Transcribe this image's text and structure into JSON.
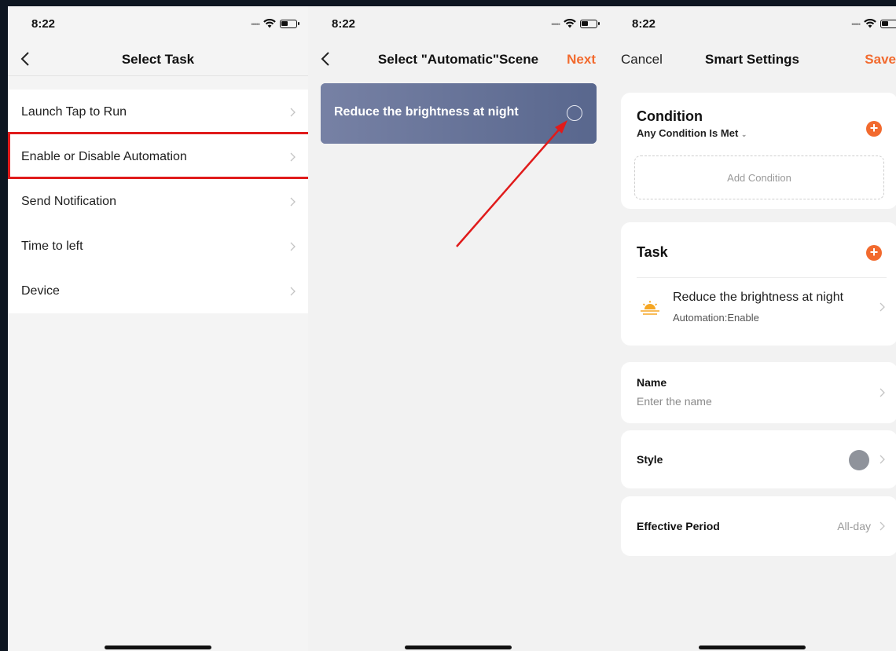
{
  "status_time": "8:22",
  "panel1": {
    "title": "Select Task",
    "items": [
      {
        "label": "Launch Tap to Run"
      },
      {
        "label": "Enable or Disable Automation"
      },
      {
        "label": "Send Notification"
      },
      {
        "label": "Time to left"
      },
      {
        "label": "Device"
      }
    ]
  },
  "panel2": {
    "title": "Select \"Automatic\"Scene",
    "next_label": "Next",
    "scene_label": "Reduce the brightness at night"
  },
  "panel3": {
    "cancel_label": "Cancel",
    "title": "Smart Settings",
    "save_label": "Save",
    "condition": {
      "heading": "Condition",
      "mode": "Any Condition Is Met",
      "add_label": "Add Condition"
    },
    "task": {
      "heading": "Task",
      "item_title": "Reduce the brightness at night",
      "item_sub": "Automation:Enable"
    },
    "name": {
      "label": "Name",
      "placeholder": "Enter the name"
    },
    "style": {
      "label": "Style"
    },
    "period": {
      "label": "Effective Period",
      "value": "All-day"
    }
  },
  "colors": {
    "accent": "#f26a2e",
    "highlight": "#e01b1b",
    "scene_card": "#6b7aa5",
    "style_dot": "#8f939b"
  }
}
